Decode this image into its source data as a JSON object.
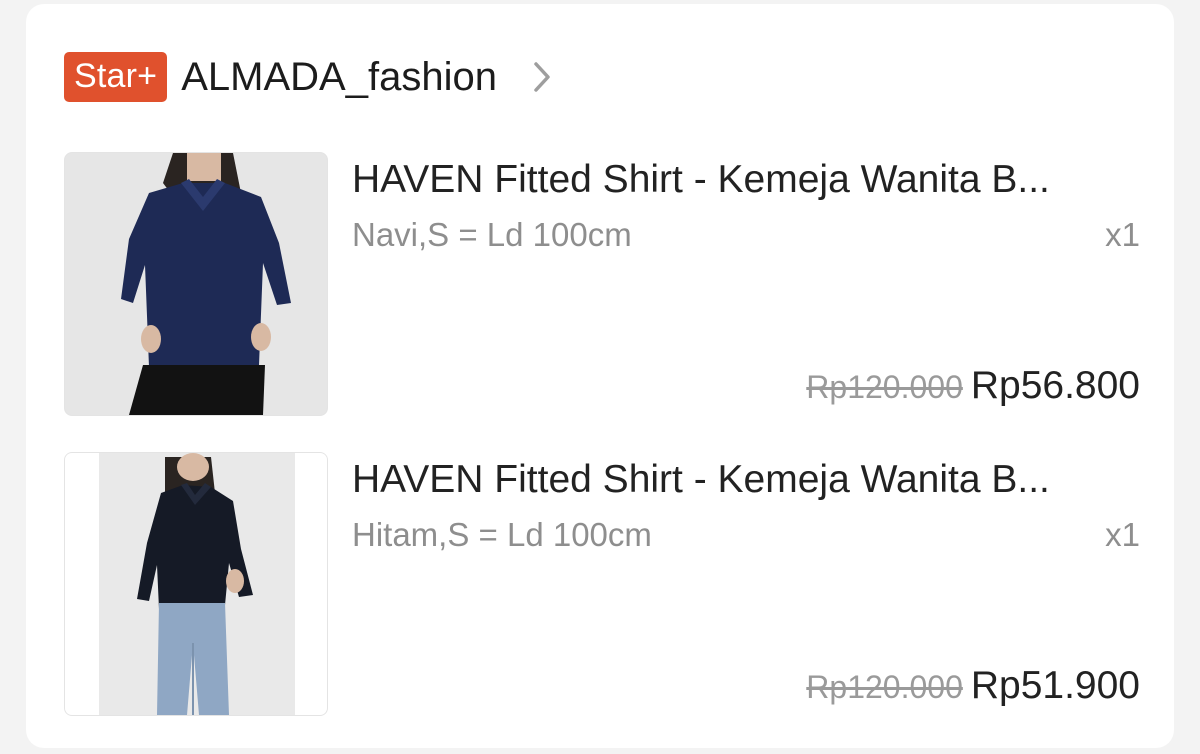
{
  "shop": {
    "badge": "Star+",
    "name": "ALMADA_fashion",
    "icon": "chevron-right-icon"
  },
  "items": [
    {
      "title": "HAVEN Fitted Shirt - Kemeja Wanita B...",
      "variant": "Navi,S = Ld 100cm",
      "quantity": "x1",
      "original_price": "Rp120.000",
      "price": "Rp56.800",
      "shirt_color": "#1e2a55"
    },
    {
      "title": "HAVEN Fitted Shirt - Kemeja Wanita B...",
      "variant": "Hitam,S = Ld 100cm",
      "quantity": "x1",
      "original_price": "Rp120.000",
      "price": "Rp51.900",
      "shirt_color": "#151a26"
    }
  ],
  "colors": {
    "badge": "#e0512d",
    "muted_text": "#8e8e8e",
    "strike_price": "#9a9a9a"
  }
}
